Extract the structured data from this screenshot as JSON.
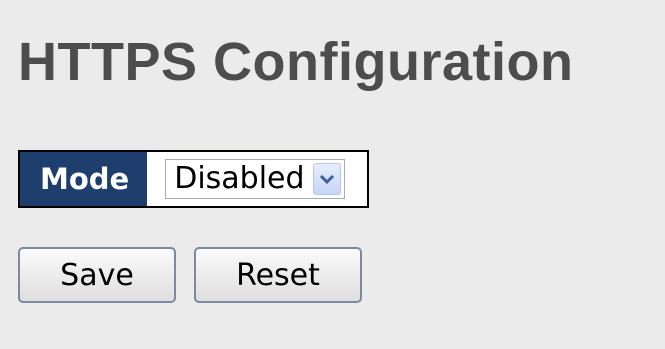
{
  "page": {
    "title": "HTTPS Configuration"
  },
  "form": {
    "mode_label": "Mode",
    "mode_value": "Disabled",
    "mode_options": [
      "Disabled"
    ]
  },
  "buttons": {
    "save_label": "Save",
    "reset_label": "Reset"
  },
  "icons": {
    "dropdown": "chevron-down-icon"
  },
  "colors": {
    "background": "#ebebeb",
    "title": "#4d4d4d",
    "label_bg": "#1e3f6e",
    "label_text": "#ffffff",
    "dropdown_arrow": "#3f5f9f"
  }
}
